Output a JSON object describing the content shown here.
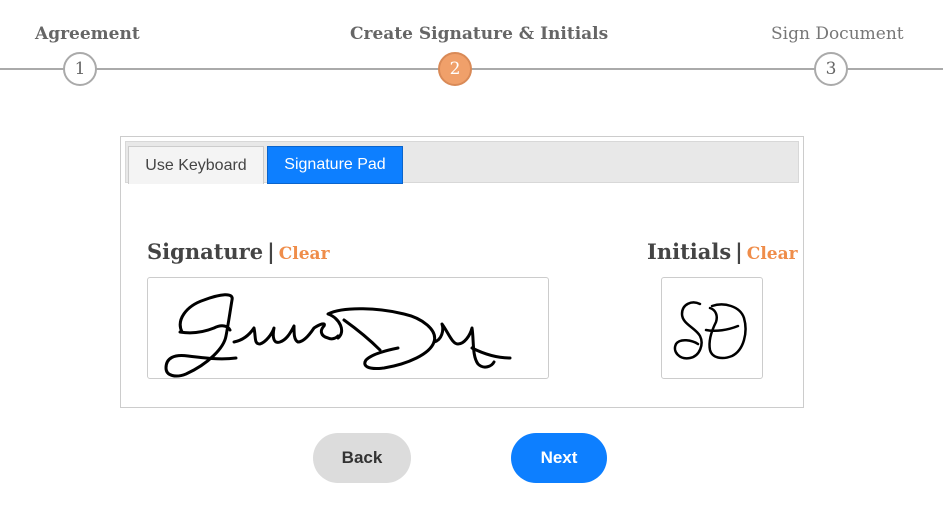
{
  "stepper": {
    "steps": [
      {
        "number": "1",
        "label": "Agreement"
      },
      {
        "number": "2",
        "label": "Create Signature & Initials"
      },
      {
        "number": "3",
        "label": "Sign Document"
      }
    ],
    "active_step": 2
  },
  "tabs": {
    "keyboard_label": "Use Keyboard",
    "pad_label": "Signature Pad"
  },
  "signature": {
    "label": "Signature",
    "separator": "|",
    "clear_label": "Clear"
  },
  "initials": {
    "label": "Initials",
    "separator": "|",
    "clear_label": "Clear"
  },
  "buttons": {
    "back_label": "Back",
    "next_label": "Next"
  },
  "colors": {
    "accent_blue": "#0d7fff",
    "active_step": "#f0a06a",
    "clear_link": "#ef8d4a"
  }
}
